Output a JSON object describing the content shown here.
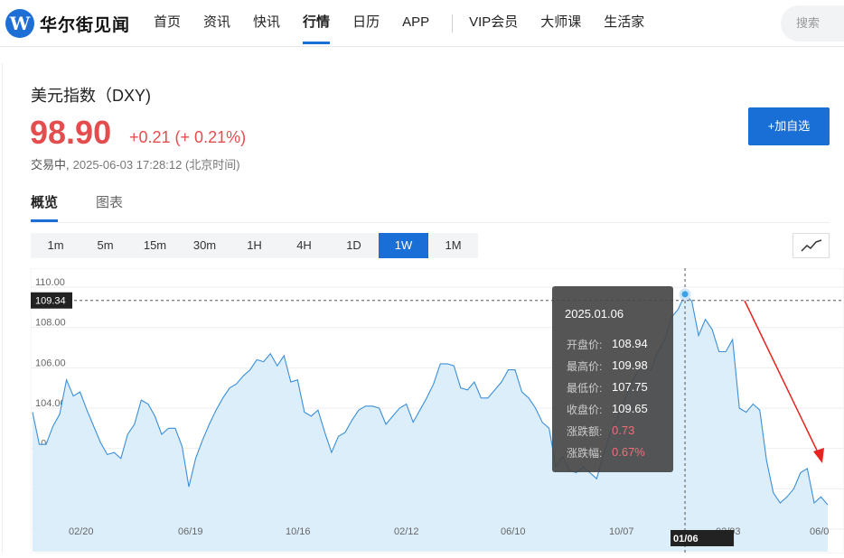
{
  "brand": {
    "name": "华尔街见闻",
    "mark": "W"
  },
  "nav": {
    "items": [
      {
        "label": "首页",
        "active": false
      },
      {
        "label": "资讯",
        "active": false
      },
      {
        "label": "快讯",
        "active": false
      },
      {
        "label": "行情",
        "active": true
      },
      {
        "label": "日历",
        "active": false
      },
      {
        "label": "APP",
        "active": false
      }
    ],
    "items2": [
      {
        "label": "VIP会员"
      },
      {
        "label": "大师课"
      },
      {
        "label": "生活家"
      }
    ],
    "search_placeholder": "搜索"
  },
  "quote": {
    "title": "美元指数（DXY)",
    "price": "98.90",
    "change": "+0.21 (+ 0.21%)",
    "status": "交易中,",
    "timestamp": "2025-06-03 17:28:12 (北京时间)",
    "watch_label": "+加自选",
    "up_color": "#e44d4d",
    "accent": "#1a6fd6"
  },
  "tabs": [
    {
      "label": "概览",
      "active": true
    },
    {
      "label": "图表",
      "active": false
    }
  ],
  "ranges": [
    "1m",
    "5m",
    "15m",
    "30m",
    "1H",
    "4H",
    "1D",
    "1W",
    "1M"
  ],
  "active_range": "1W",
  "chart_type_icon": "line-chart-icon",
  "tooltip": {
    "date": "2025.01.06",
    "rows": [
      {
        "label": "开盘价:",
        "value": "108.94",
        "highlight": false
      },
      {
        "label": "最高价:",
        "value": "109.98",
        "highlight": false
      },
      {
        "label": "最低价:",
        "value": "107.75",
        "highlight": false
      },
      {
        "label": "收盘价:",
        "value": "109.65",
        "highlight": false
      },
      {
        "label": "涨跌额:",
        "value": "0.73",
        "highlight": true
      },
      {
        "label": "涨跌幅:",
        "value": "0.67%",
        "highlight": true
      }
    ]
  },
  "chart_data": {
    "type": "area",
    "ylim": [
      98,
      110
    ],
    "yticks": [
      "110.00",
      "108.00",
      "106.00",
      "104.00",
      "102.00",
      "100.00",
      "98.00"
    ],
    "xticks": [
      "02/20",
      "06/19",
      "10/16",
      "02/12",
      "06/10",
      "10/07",
      "02/03",
      "06/0"
    ],
    "crosshair_x_label": "01/06",
    "crosshair_y_label": "109.34",
    "line_color": "#3a8fd9",
    "fill_color": "#ddeefb",
    "values": [
      103.8,
      102.2,
      102.2,
      103.1,
      103.7,
      105.4,
      104.6,
      104.8,
      103.9,
      103.1,
      102.3,
      101.7,
      101.8,
      101.5,
      102.7,
      103.2,
      104.4,
      104.2,
      103.6,
      102.7,
      103,
      103,
      102.1,
      100.1,
      101.5,
      102.4,
      103.2,
      103.9,
      104.5,
      105,
      105.2,
      105.6,
      105.9,
      106.4,
      106.3,
      106.7,
      106.1,
      106.6,
      105.3,
      105.4,
      103.8,
      103.6,
      103.9,
      102.8,
      101.8,
      102.6,
      102.8,
      103.4,
      103.9,
      104.1,
      104.1,
      104,
      103.2,
      103.6,
      104,
      104.2,
      103.3,
      103.9,
      104.5,
      105.2,
      106.2,
      106.2,
      106.1,
      105,
      104.9,
      105.3,
      104.5,
      104.5,
      104.9,
      105.3,
      105.9,
      105.9,
      104.8,
      104.5,
      104,
      103.3,
      103,
      101.1,
      101.6,
      100.9,
      100.8,
      101.1,
      100.8,
      100.5,
      101.7,
      102.8,
      103.5,
      104.3,
      105.2,
      105.8,
      106,
      105.9,
      106.8,
      107.4,
      108.5,
      108.9,
      109.65,
      109.3,
      107.6,
      108.4,
      107.9,
      106.8,
      106.8,
      107.4,
      104,
      103.8,
      104.2,
      103.9,
      101.4,
      99.8,
      99.3,
      99.6,
      100,
      100.8,
      101,
      99.3,
      99.6,
      99.2
    ]
  }
}
